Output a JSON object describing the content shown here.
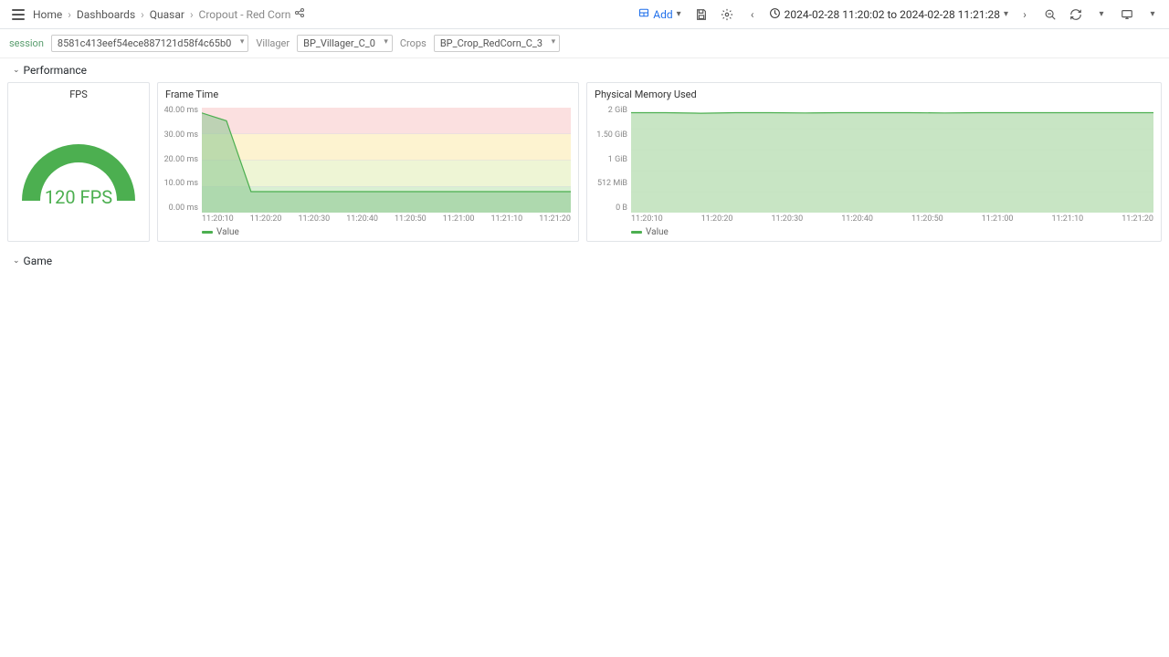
{
  "breadcrumb": {
    "home": "Home",
    "dashboards": "Dashboards",
    "folder": "Quasar",
    "current": "Cropout - Red Corn"
  },
  "toolbar": {
    "add_label": "Add",
    "time_range": "2024-02-28 11:20:02 to 2024-02-28 11:21:28"
  },
  "vars": {
    "session_label": "session",
    "session_value": "8581c413eef54ece887121d58f4c65b0",
    "villager_label": "Villager",
    "villager_value": "BP_Villager_C_0",
    "crops_label": "Crops",
    "crops_value": "BP_Crop_RedCorn_C_3"
  },
  "rows": {
    "performance": "Performance",
    "game": "Game"
  },
  "panels": {
    "fps": {
      "title": "FPS",
      "display": "120 FPS"
    },
    "frame_time": {
      "title": "Frame Time",
      "legend": "Value"
    },
    "memory": {
      "title": "Physical Memory Used",
      "legend": "Value"
    }
  },
  "chart_data": [
    {
      "type": "gauge",
      "panel": "fps",
      "value": 120,
      "unit": "FPS"
    },
    {
      "type": "area",
      "panel": "frame_time",
      "x": [
        "11:20:10",
        "11:20:20",
        "11:20:30",
        "11:20:40",
        "11:20:50",
        "11:21:00",
        "11:21:10",
        "11:21:20"
      ],
      "y_ticks": [
        "40.00 ms",
        "30.00 ms",
        "20.00 ms",
        "10.00 ms",
        "0.00 ms"
      ],
      "ylim": [
        0,
        40
      ],
      "ylabel": "ms",
      "series": [
        {
          "name": "Value",
          "values": [
            38,
            35,
            8,
            8,
            8,
            8,
            8,
            8,
            8,
            8,
            8,
            8,
            8,
            8,
            8,
            8
          ]
        }
      ],
      "thresholds": [
        {
          "from": 0,
          "to": 10,
          "color": "#d9f0d3"
        },
        {
          "from": 10,
          "to": 20,
          "color": "#eef5d5"
        },
        {
          "from": 20,
          "to": 30,
          "color": "#fdf3d0"
        },
        {
          "from": 30,
          "to": 40,
          "color": "#fbe0e0"
        }
      ]
    },
    {
      "type": "area",
      "panel": "memory",
      "x": [
        "11:20:10",
        "11:20:20",
        "11:20:30",
        "11:20:40",
        "11:20:50",
        "11:21:00",
        "11:21:10",
        "11:21:20"
      ],
      "y_ticks": [
        "2 GiB",
        "1.50 GiB",
        "1 GiB",
        "512 MiB",
        "0 B"
      ],
      "ylim": [
        0,
        2048
      ],
      "ylabel": "bytes",
      "series": [
        {
          "name": "Value",
          "values": [
            1950,
            1950,
            1940,
            1950,
            1950,
            1945,
            1950,
            1950,
            1950,
            1945,
            1950,
            1950,
            1950,
            1950,
            1950,
            1950
          ]
        }
      ]
    }
  ]
}
